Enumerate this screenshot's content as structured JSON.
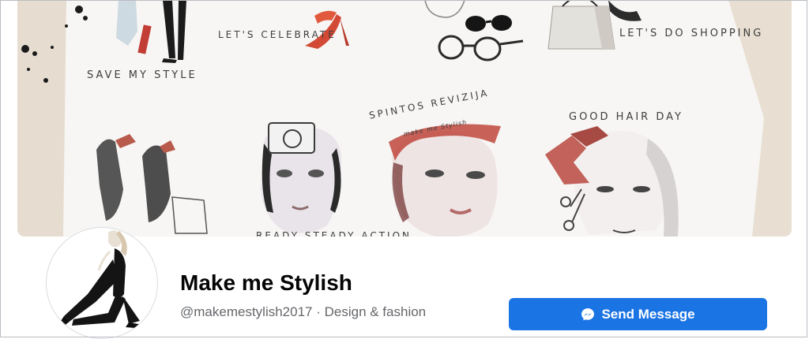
{
  "cover": {
    "captions": {
      "save_my_style": "SAVE MY STYLE",
      "lets_celebrate": "LET'S CELEBRATE",
      "lets_do_shopping": "LET'S DO SHOPPING",
      "good_hair_day": "GOOD HAIR DAY",
      "spintos_revizija": "SPINTOS REVIZIJA",
      "make_me_stylish": "make me Stylish",
      "ready_steady_action": "READY STEADY ACTION"
    }
  },
  "profile": {
    "name": "Make me Stylish",
    "handle": "@makemestylish2017",
    "separator": " · ",
    "category": "Design & fashion"
  },
  "actions": {
    "send_message_label": "Send Message"
  },
  "icons": {
    "send_message": "messenger-icon"
  },
  "colors": {
    "primary_button": "#1b74e4",
    "name_text": "#050505",
    "meta_text": "#65676b"
  }
}
